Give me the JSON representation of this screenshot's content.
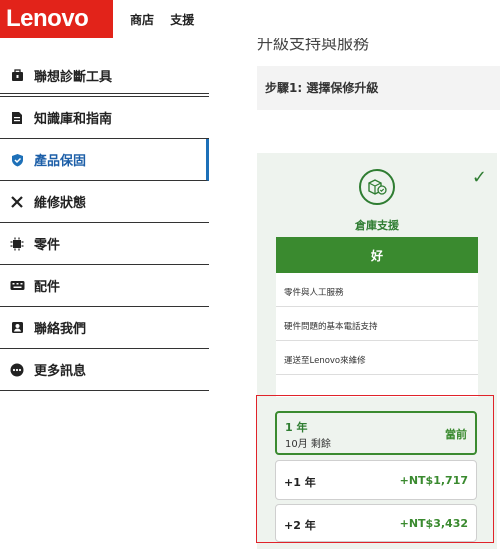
{
  "header": {
    "logo": "Lenovo",
    "nav": [
      "商店",
      "支援"
    ]
  },
  "sidebar": {
    "items": [
      {
        "label": "聯想診斷工具",
        "icon": "toolbox-icon"
      },
      {
        "label": "知識庫和指南",
        "icon": "document-icon"
      },
      {
        "label": "產品保固",
        "icon": "shield-check-icon",
        "active": true
      },
      {
        "label": "維修狀態",
        "icon": "wrench-screwdriver-icon"
      },
      {
        "label": "零件",
        "icon": "chip-icon"
      },
      {
        "label": "配件",
        "icon": "keyboard-icon"
      },
      {
        "label": "聯絡我們",
        "icon": "contact-icon"
      },
      {
        "label": "更多訊息",
        "icon": "more-icon"
      }
    ],
    "active_color": "#1d70b8"
  },
  "main": {
    "page_title": "升級支持與服務",
    "step": "步驟1: 選擇保修升級",
    "plan": {
      "name": "倉庫支援",
      "button_label": "好",
      "features": [
        "零件與人工服務",
        "硬件問題的基本電話支持",
        "運送至Lenovo來維修"
      ],
      "accent": "#3a8a2f"
    },
    "options": [
      {
        "term": "1 年",
        "subtitle": "10月 剩餘",
        "price": "當前",
        "current": true
      },
      {
        "term": "+1 年",
        "price": "+NT$1,717"
      },
      {
        "term": "+2 年",
        "price": "+NT$3,432"
      }
    ]
  }
}
